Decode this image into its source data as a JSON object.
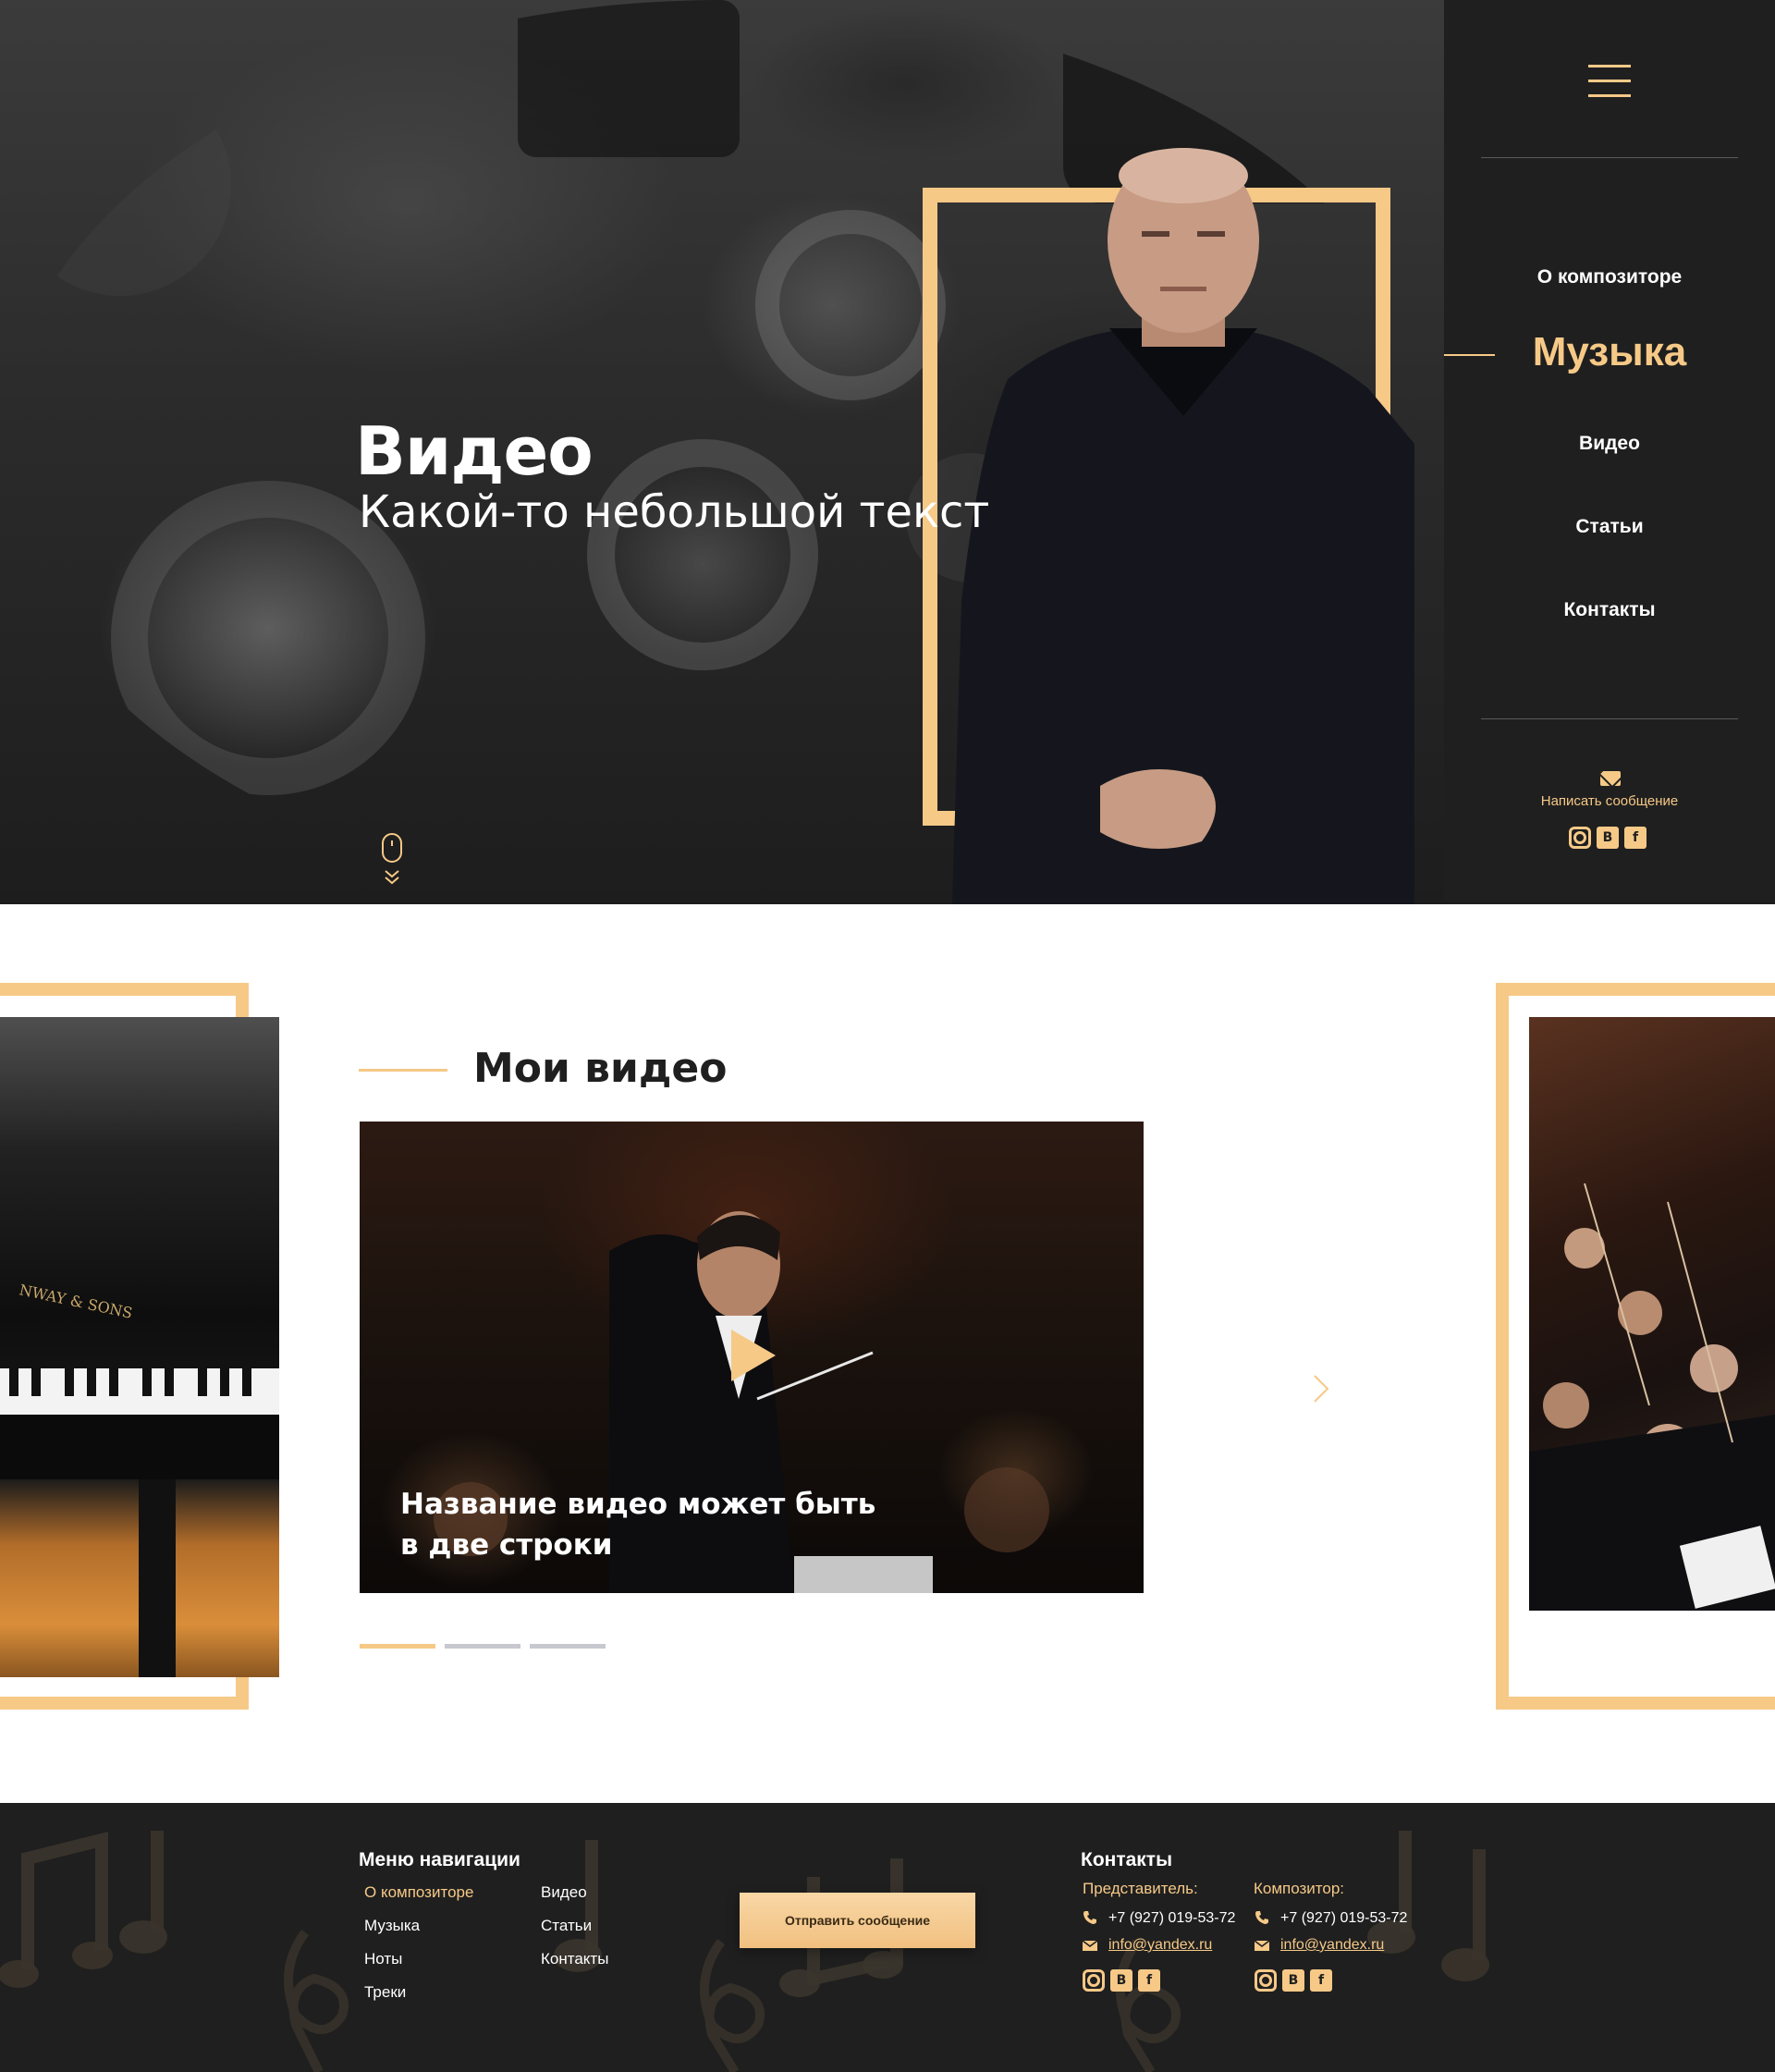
{
  "hero": {
    "title": "Видео",
    "subtitle": "Какой-то небольшой текст"
  },
  "sidebar": {
    "menu_icon": "hamburger-icon",
    "items": [
      {
        "label": "О композиторе",
        "active": false
      },
      {
        "label": "Музыка",
        "active": true
      },
      {
        "label": "Видео",
        "active": false
      },
      {
        "label": "Статьи",
        "active": false
      },
      {
        "label": "Контакты",
        "active": false
      }
    ],
    "write_message": "Написать сообщение",
    "socials": [
      "instagram-icon",
      "vk-icon",
      "facebook-icon"
    ],
    "vk_letter": "B",
    "fb_letter": "f"
  },
  "videos": {
    "section_title": "Мои видео",
    "current": {
      "caption_line1": "Название видео может быть",
      "caption_line2": "в две строки"
    },
    "slides_total": 3,
    "active_slide": 1
  },
  "footer": {
    "nav_title": "Меню навигации",
    "nav_col1": [
      "О композиторе",
      "Музыка",
      "Ноты",
      "Треки"
    ],
    "nav_col2": [
      "Видео",
      "Статьи",
      "Контакты"
    ],
    "send_button": "Отправить сообщение",
    "contacts_title": "Контакты",
    "representative": {
      "label": "Представитель:",
      "phone": "+7 (927) 019-53-72",
      "email": "info@yandex.ru"
    },
    "composer": {
      "label": "Композитор:",
      "phone": "+7 (927) 019-53-72",
      "email": "info@yandex.ru"
    }
  },
  "colors": {
    "accent": "#f6c987",
    "dark": "#1f1f1f",
    "white": "#ffffff"
  }
}
